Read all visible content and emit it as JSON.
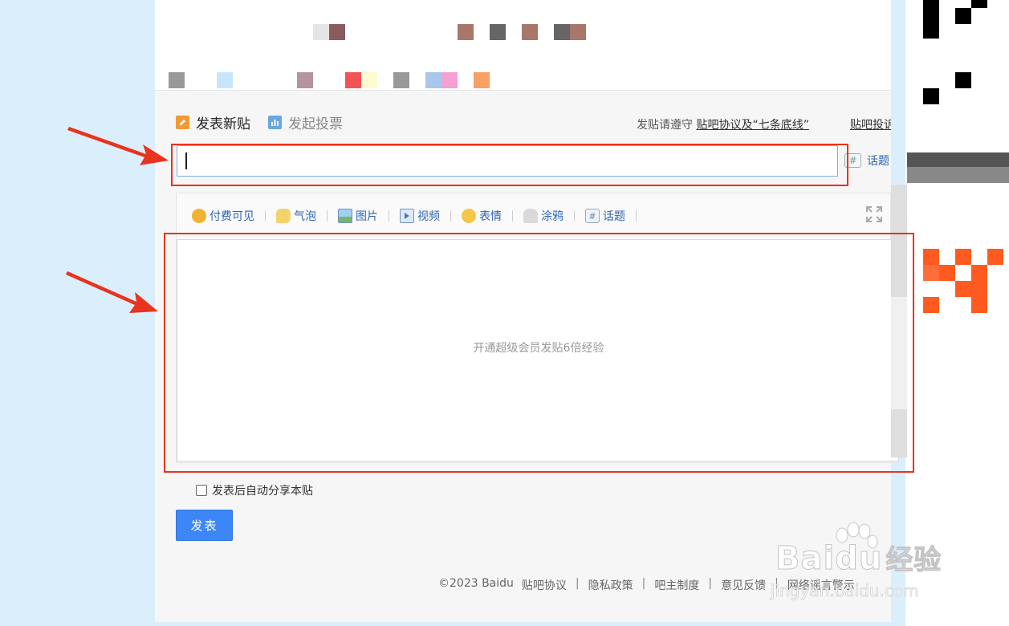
{
  "header": {
    "tab_post_label": "发表新贴",
    "tab_vote_label": "发起投票",
    "notice_prefix": "发贴请遵守",
    "notice_link": "贴吧协议及“七条底线”",
    "complaint_link": "贴吧投诉"
  },
  "title_input": {
    "value": "",
    "placeholder": ""
  },
  "topic_button": {
    "icon": "#",
    "label": "话题"
  },
  "toolbar": {
    "items": [
      {
        "label": "付费可见",
        "icon": "coin-icon",
        "color": "#f1b233"
      },
      {
        "label": "气泡",
        "icon": "bubble-icon",
        "color": "#f5d36b"
      },
      {
        "label": "图片",
        "icon": "image-icon",
        "color": "#7bb0d9"
      },
      {
        "label": "视频",
        "icon": "video-icon",
        "color": "#6f93c2"
      },
      {
        "label": "表情",
        "icon": "smiley-icon",
        "color": "#f3c84a"
      },
      {
        "label": "涂鸦",
        "icon": "graffiti-icon",
        "color": "#b9b9b9"
      },
      {
        "label": "话题",
        "icon": "hashtag-icon",
        "color": "#8fa9c7"
      }
    ]
  },
  "editor": {
    "placeholder": "开通超级会员发贴6倍经验"
  },
  "share": {
    "label": "发表后自动分享本贴",
    "checked": false
  },
  "submit": {
    "label": "发表"
  },
  "footer": {
    "copyright": "©2023 Baidu",
    "links": [
      "贴吧协议",
      "隐私政策",
      "吧主制度",
      "意见反馈",
      "网络谣言警示"
    ]
  },
  "watermark": {
    "brand": "Baidu",
    "suffix": "经验",
    "url": "jingyan.baidu.com"
  },
  "colors": {
    "accent": "#3c87f5",
    "link": "#2d64b3",
    "annotation": "#e8331f",
    "background": "#dbeefc"
  }
}
